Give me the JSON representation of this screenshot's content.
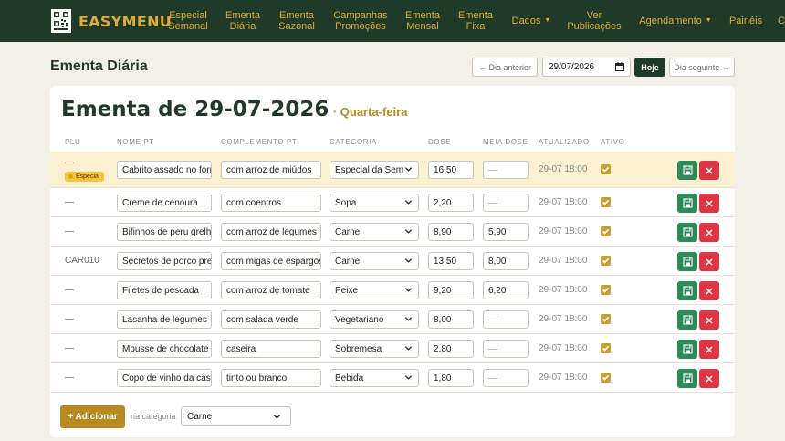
{
  "navbar": {
    "brand": "EASYMENU",
    "items": [
      {
        "line1": "Especial",
        "line2": "Semanal"
      },
      {
        "line1": "Ementa",
        "line2": "Diária"
      },
      {
        "line1": "Ementa",
        "line2": "Sazonal"
      },
      {
        "line1": "Campanhas",
        "line2": "Promoções"
      },
      {
        "line1": "Ementa",
        "line2": "Mensal"
      },
      {
        "line1": "Ementa",
        "line2": "Fixa"
      },
      {
        "line1": "Dados",
        "line2": ""
      },
      {
        "line1": "Ver",
        "line2": "Publicações"
      },
      {
        "line1": "Agendamento",
        "line2": ""
      },
      {
        "line1": "Painéis",
        "line2": ""
      },
      {
        "line1": "C",
        "line2": ""
      }
    ],
    "colors": {
      "bg": "#1f3a29",
      "accent": "#e0ad3a"
    }
  },
  "header": {
    "page_title": "Ementa Diária",
    "prev_label": "← Dia anterior",
    "date_value": "29/07/2026",
    "today_label": "Hoje",
    "next_label": "Dia seguinte →"
  },
  "card": {
    "title": "Ementa de 29-07-2026",
    "weekday": "· Quarta-feira"
  },
  "table": {
    "headers": [
      "PLU",
      "NOME PT",
      "COMPLEMENTO PT",
      "CATEGORIA",
      "DOSE",
      "MEIA DOSE",
      "ATUALIZADO",
      "ATIVO"
    ],
    "rows": [
      {
        "plu": "—",
        "badge": "Especial",
        "nome": "Cabrito assado no forr",
        "complemento": "com arroz de miúdos",
        "categoria": "Especial da Sema",
        "dose": "16,50",
        "meia": "—",
        "atualizado": "29-07 18:00",
        "ativo": true
      },
      {
        "plu": "—",
        "nome": "Creme de cenoura",
        "complemento": "com coentros",
        "categoria": "Sopa",
        "dose": "2,20",
        "meia": "—",
        "atualizado": "29-07 18:00",
        "ativo": true
      },
      {
        "plu": "—",
        "nome": "Bifinhos de peru grelha",
        "complemento": "com arroz de legumes",
        "categoria": "Carne",
        "dose": "8,90",
        "meia": "5,90",
        "atualizado": "29-07 18:00",
        "ativo": true
      },
      {
        "plu": "CAR010",
        "nome": "Secretos de porco pret",
        "complemento": "com migas de espargos",
        "categoria": "Carne",
        "dose": "13,50",
        "meia": "8,00",
        "atualizado": "29-07 18:00",
        "ativo": true
      },
      {
        "plu": "—",
        "nome": "Filetes de pescada",
        "complemento": "com arroz de tomate",
        "categoria": "Peixe",
        "dose": "9,20",
        "meia": "6,20",
        "atualizado": "29-07 18:00",
        "ativo": true
      },
      {
        "plu": "—",
        "nome": "Lasanha de legumes",
        "complemento": "com salada verde",
        "categoria": "Vegetariano",
        "dose": "8,00",
        "meia": "—",
        "atualizado": "29-07 18:00",
        "ativo": true
      },
      {
        "plu": "—",
        "nome": "Mousse de chocolate",
        "complemento": "caseira",
        "categoria": "Sobremesa",
        "dose": "2,80",
        "meia": "—",
        "atualizado": "29-07 18:00",
        "ativo": true
      },
      {
        "plu": "—",
        "nome": "Copo de vinho da casa",
        "complemento": "tinto ou branco",
        "categoria": "Bebida",
        "dose": "1,80",
        "meia": "—",
        "atualizado": "29-07 18:00",
        "ativo": true
      }
    ]
  },
  "footer": {
    "add_label": "+ Adicionar",
    "in_category_label": "na categoria",
    "category_value": "Carne"
  },
  "icons": {
    "save": "floppy-disk-icon",
    "delete": "x-icon",
    "check": "checkmark-icon",
    "calendar": "calendar-icon",
    "chevron": "chevron-down-icon"
  }
}
